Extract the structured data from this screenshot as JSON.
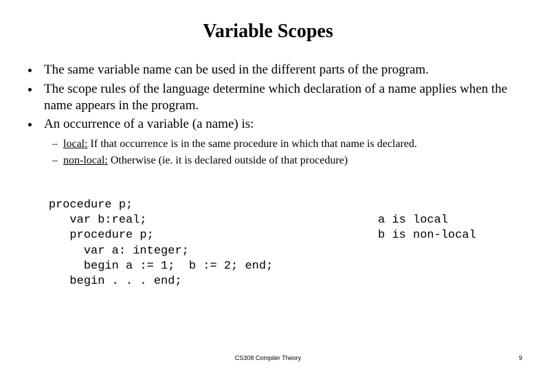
{
  "title": "Variable Scopes",
  "bullets": {
    "b1": "The same variable name can be used in the different parts of the program.",
    "b2": "The scope rules of the language determine which declaration of a name applies when the name appears in the program.",
    "b3": "An occurrence of a variable (a name) is:",
    "sub1_label": "local:",
    "sub1_rest": " If that occurrence is in the same procedure in which that name is declared.",
    "sub2_label": "non-local:",
    "sub2_rest": " Otherwise (ie. it is declared outside of that procedure)"
  },
  "code": {
    "l1": "procedure p;",
    "l2": "   var b:real;",
    "l3": "   procedure p;",
    "l4": "     var a: integer;",
    "l5": "     begin a := 1;  b := 2; end;",
    "l6": "   begin . . . end;"
  },
  "annot": {
    "a1": "a is local",
    "a2": "b is non-local"
  },
  "footer": "CS308 Compiler Theory",
  "pagenum": "9"
}
